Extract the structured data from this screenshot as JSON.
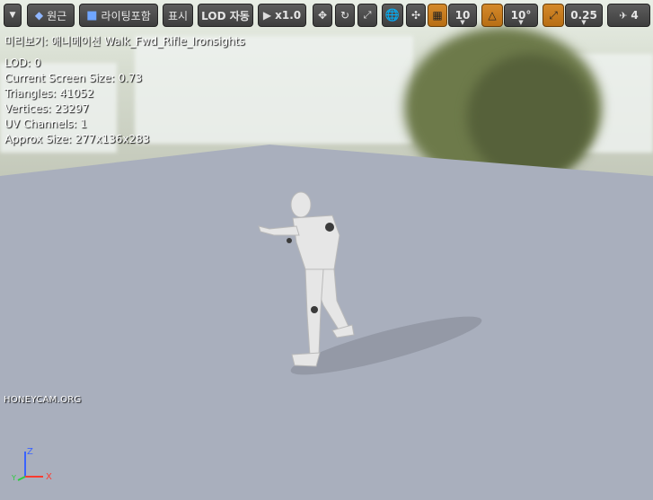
{
  "toolbar": {
    "perspective_label": "원근",
    "lighting_label": "라이팅포함",
    "show_label": "표시",
    "lod_label": "LOD 자동",
    "speed_label": "x1.0",
    "grid_value": "10",
    "angle_value": "10°",
    "scale_value": "0.25",
    "camera_speed_value": "4"
  },
  "viewport": {
    "preview_title": "미리보기: 애니메이션 Walk_Fwd_Rifle_Ironsights",
    "stats": [
      "LOD: 0",
      "Current Screen Size: 0.73",
      "Triangles: 41052",
      "Vertices: 23297",
      "UV Channels: 1",
      "Approx Size: 277x136x283"
    ],
    "watermark": "HONEYCAM.ORG",
    "axis_z": "Z",
    "axis_x": "X",
    "axis_y": "Y"
  },
  "colors": {
    "orange_active": "#c47a1c",
    "floor": "#a9afbd",
    "axis_x": "#ff3b30",
    "axis_z": "#3a63ff",
    "axis_y": "#2ecc40"
  }
}
